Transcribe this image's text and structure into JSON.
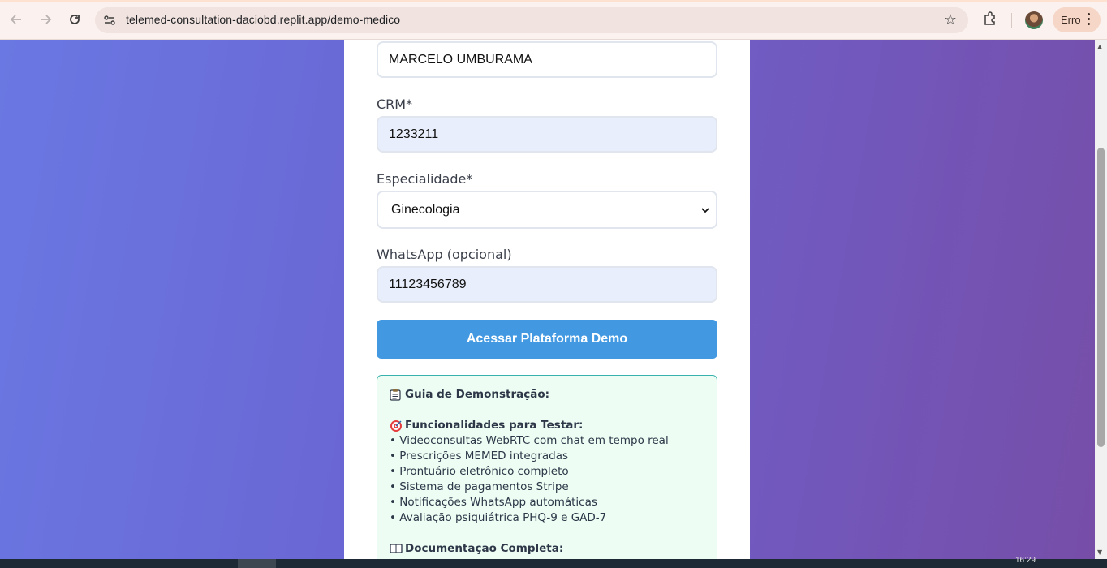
{
  "browser": {
    "url": "telemed-consultation-daciobd.replit.app/demo-medico",
    "profile_chip_label": "Erro"
  },
  "form": {
    "name_value": "MARCELO UMBURAMA",
    "crm_label": "CRM*",
    "crm_value": "1233211",
    "specialty_label": "Especialidade*",
    "specialty_selected": "Ginecologia",
    "whatsapp_label": "WhatsApp (opcional)",
    "whatsapp_value": "11123456789",
    "submit_label": "Acessar Plataforma Demo"
  },
  "guide": {
    "title": "Guia de Demonstração:",
    "features_title": "Funcionalidades para Testar:",
    "features": [
      "• Videoconsultas WebRTC com chat em tempo real",
      "• Prescrições MEMED integradas",
      "• Prontuário eletrônico completo",
      "• Sistema de pagamentos Stripe",
      "• Notificações WhatsApp automáticas",
      "• Avaliação psiquiátrica PHQ-9 e GAD-7"
    ],
    "docs_title": "Documentação Completa:"
  },
  "taskbar": {
    "clock": "16:29"
  },
  "colors": {
    "page_gradient_start": "#6a78e3",
    "page_gradient_end": "#764ea8",
    "cta": "#4299e1",
    "guide_border": "#38b2ac",
    "guide_bg": "#edfdf3"
  }
}
